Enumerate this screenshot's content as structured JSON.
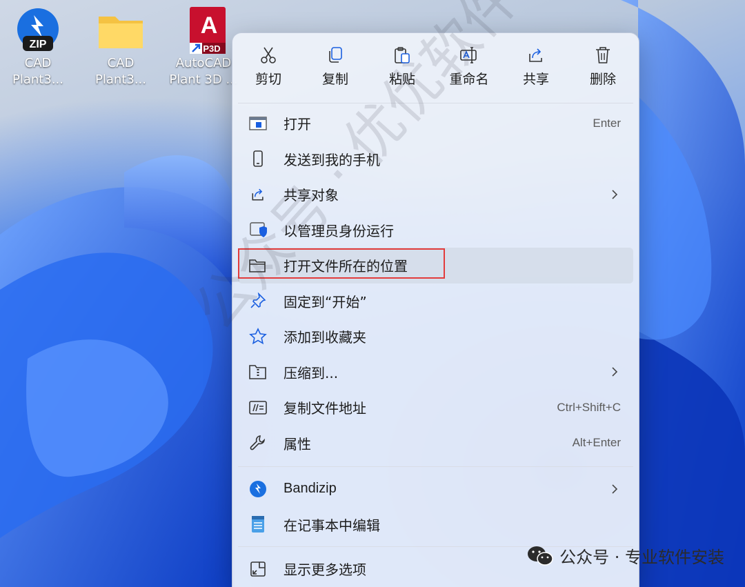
{
  "desktop": {
    "icons": [
      {
        "label_line1": "CAD",
        "label_line2": "Plant3...",
        "icon": "zip-archive-icon",
        "badge": "ZIP"
      },
      {
        "label_line1": "CAD",
        "label_line2": "Plant3...",
        "icon": "folder-icon"
      },
      {
        "label_line1": "AutoCAD",
        "label_line2": "Plant 3D ...",
        "icon": "autocad-plant3d-shortcut-icon",
        "badge_letter": "A",
        "badge": "P3D"
      }
    ]
  },
  "context_menu": {
    "quick_actions": [
      {
        "label": "剪切",
        "icon": "cut-icon"
      },
      {
        "label": "复制",
        "icon": "copy-icon"
      },
      {
        "label": "粘贴",
        "icon": "paste-icon"
      },
      {
        "label": "重命名",
        "icon": "rename-icon"
      },
      {
        "label": "共享",
        "icon": "share-icon"
      },
      {
        "label": "删除",
        "icon": "delete-icon"
      }
    ],
    "items": [
      {
        "label": "打开",
        "shortcut": "Enter",
        "icon": "open-app-icon"
      },
      {
        "label": "发送到我的手机",
        "icon": "phone-icon"
      },
      {
        "label": "共享对象",
        "icon": "share-icon",
        "submenu": true
      },
      {
        "label": "以管理员身份运行",
        "icon": "shield-admin-icon"
      },
      {
        "label": "打开文件所在的位置",
        "icon": "folder-open-icon",
        "highlighted": true
      },
      {
        "label": "固定到“开始”",
        "icon": "pin-icon"
      },
      {
        "label": "添加到收藏夹",
        "icon": "star-icon"
      },
      {
        "label": "压缩到...",
        "icon": "zip-folder-icon",
        "submenu": true
      },
      {
        "label": "复制文件地址",
        "shortcut": "Ctrl+Shift+C",
        "icon": "copy-path-icon"
      },
      {
        "label": "属性",
        "shortcut": "Alt+Enter",
        "icon": "wrench-icon"
      },
      {
        "label": "Bandizip",
        "icon": "bandizip-icon",
        "submenu": true
      },
      {
        "label": "在记事本中编辑",
        "icon": "notepad-icon"
      },
      {
        "label": "显示更多选项",
        "icon": "more-options-icon"
      }
    ]
  },
  "watermark": {
    "text": "公众号 · 优优软件安装"
  },
  "footer": {
    "text": "公众号 · 专业软件安装",
    "icon": "wechat-icon"
  },
  "colors": {
    "highlight_border": "#e23b3b",
    "accent": "#1a5fe0"
  }
}
